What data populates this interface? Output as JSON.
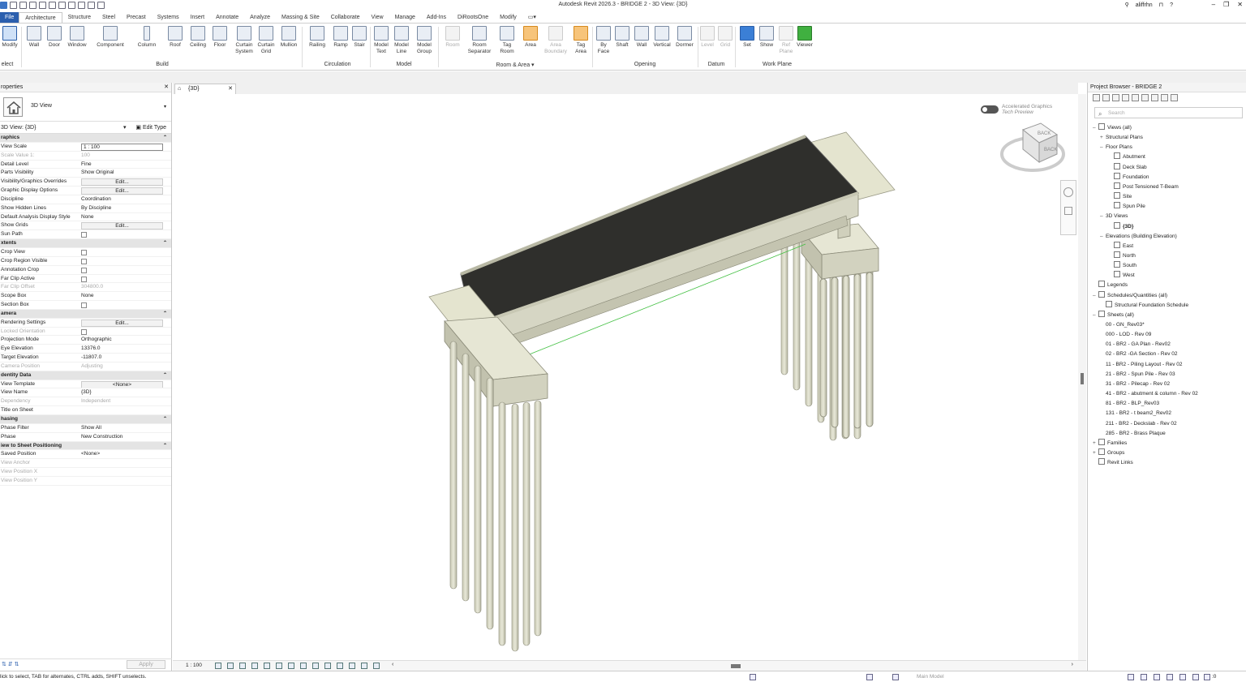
{
  "app": {
    "title": "Autodesk Revit 2026.3 - BRIDGE 2 - 3D View: {3D}",
    "user": "aliffrhn"
  },
  "ribbon": {
    "tabs": [
      "File",
      "Architecture",
      "Structure",
      "Steel",
      "Precast",
      "Systems",
      "Insert",
      "Annotate",
      "Analyze",
      "Massing & Site",
      "Collaborate",
      "View",
      "Manage",
      "Add-Ins",
      "DiRootsOne",
      "Modify"
    ],
    "active_tab": "Architecture",
    "select_label": "elect",
    "tools": {
      "modify": "Modify",
      "wall": "Wall",
      "door": "Door",
      "window": "Window",
      "component": "Component",
      "column": "Column",
      "roof": "Roof",
      "ceiling": "Ceiling",
      "floor": "Floor",
      "curtain_system": "Curtain System",
      "curtain_grid": "Curtain Grid",
      "mullion": "Mullion",
      "railing": "Railing",
      "ramp": "Ramp",
      "stair": "Stair",
      "model_text": "Model Text",
      "model_line": "Model Line",
      "model_group": "Model Group",
      "room": "Room",
      "room_separator": "Room Separator",
      "tag_room": "Tag Room",
      "area": "Area",
      "area_boundary": "Area Boundary",
      "tag_area": "Tag Area",
      "by_face": "By Face",
      "shaft": "Shaft",
      "wall_opening": "Wall",
      "vertical": "Vertical",
      "dormer": "Dormer",
      "level": "Level",
      "grid": "Grid",
      "set": "Set",
      "show": "Show",
      "ref_plane": "Ref Plane",
      "viewer": "Viewer"
    },
    "groups": {
      "build": "Build",
      "circulation": "Circulation",
      "model": "Model",
      "room_area": "Room & Area ▾",
      "opening": "Opening",
      "datum": "Datum",
      "work_plane": "Work Plane"
    }
  },
  "properties": {
    "header": "roperties",
    "type_name": "3D View",
    "selector": "3D View: {3D}",
    "edit_type": "Edit Type",
    "apply": "Apply",
    "help": "Properties help",
    "rows": [
      {
        "kind": "section",
        "k": "raphics"
      },
      {
        "k": "View Scale",
        "v": "1 : 100",
        "ctl": "box"
      },
      {
        "k": "Scale Value    1:",
        "v": "100",
        "dim": true
      },
      {
        "k": "Detail Level",
        "v": "Fine"
      },
      {
        "k": "Parts Visibility",
        "v": "Show Original"
      },
      {
        "k": "Visibility/Graphics Overrides",
        "v": "Edit...",
        "ctl": "btn"
      },
      {
        "k": "Graphic Display Options",
        "v": "Edit...",
        "ctl": "btn"
      },
      {
        "k": "Discipline",
        "v": "Coordination"
      },
      {
        "k": "Show Hidden Lines",
        "v": "By Discipline"
      },
      {
        "k": "Default Analysis Display Style",
        "v": "None"
      },
      {
        "k": "Show Grids",
        "v": "Edit...",
        "ctl": "btn"
      },
      {
        "k": "Sun Path",
        "ctl": "chk"
      },
      {
        "kind": "section",
        "k": "xtents"
      },
      {
        "k": "Crop View",
        "ctl": "chk"
      },
      {
        "k": "Crop Region Visible",
        "ctl": "chk"
      },
      {
        "k": "Annotation Crop",
        "ctl": "chk"
      },
      {
        "k": "Far Clip Active",
        "ctl": "chk"
      },
      {
        "k": "Far Clip Offset",
        "v": "304800.0",
        "dim": true
      },
      {
        "k": "Scope Box",
        "v": "None"
      },
      {
        "k": "Section Box",
        "ctl": "chk"
      },
      {
        "kind": "section",
        "k": "amera"
      },
      {
        "k": "Rendering Settings",
        "v": "Edit...",
        "ctl": "btn"
      },
      {
        "k": "Locked Orientation",
        "ctl": "chk",
        "dim": true
      },
      {
        "k": "Projection Mode",
        "v": "Orthographic"
      },
      {
        "k": "Eye Elevation",
        "v": "13376.0"
      },
      {
        "k": "Target Elevation",
        "v": "-11807.0"
      },
      {
        "k": "Camera Position",
        "v": "Adjusting",
        "dim": true
      },
      {
        "kind": "section",
        "k": "dentity Data"
      },
      {
        "k": "View Template",
        "v": "<None>",
        "ctl": "btn"
      },
      {
        "k": "View Name",
        "v": "{3D}"
      },
      {
        "k": "Dependency",
        "v": "Independent",
        "dim": true
      },
      {
        "k": "Title on Sheet",
        "v": ""
      },
      {
        "kind": "section",
        "k": "hasing"
      },
      {
        "k": "Phase Filter",
        "v": "Show All"
      },
      {
        "k": "Phase",
        "v": "New Construction"
      },
      {
        "kind": "section",
        "k": "iew to Sheet Positioning"
      },
      {
        "k": "Saved Position",
        "v": "<None>"
      },
      {
        "k": "View Anchor",
        "v": "",
        "dim": true
      },
      {
        "k": "View Position X",
        "v": "",
        "dim": true
      },
      {
        "k": "View Position Y",
        "v": "",
        "dim": true
      }
    ]
  },
  "view": {
    "tab_label": "{3D}",
    "scale": "1 : 100",
    "accel_title": "Accelerated Graphics",
    "accel_sub": "Tech Preview",
    "cube_top": "BACK",
    "cube_side": "BACK"
  },
  "browser": {
    "title": "Project Browser - BRIDGE 2",
    "search_placeholder": "Search",
    "tree": [
      {
        "t": "Views (all)",
        "l": 0,
        "tg": "–",
        "ic": true
      },
      {
        "t": "Structural Plans",
        "l": 1,
        "tg": "+"
      },
      {
        "t": "Floor Plans",
        "l": 1,
        "tg": "–"
      },
      {
        "t": "Abutment",
        "l": 2,
        "ic": true
      },
      {
        "t": "Deck Slab",
        "l": 2,
        "ic": true
      },
      {
        "t": "Foundation",
        "l": 2,
        "ic": true
      },
      {
        "t": "Post Tensioned T-Beam",
        "l": 2,
        "ic": true
      },
      {
        "t": "Site",
        "l": 2,
        "ic": true
      },
      {
        "t": "Spun Pile",
        "l": 2,
        "ic": true
      },
      {
        "t": "3D Views",
        "l": 1,
        "tg": "–"
      },
      {
        "t": "{3D}",
        "l": 2,
        "ic": true,
        "bold": true
      },
      {
        "t": "Elevations (Building Elevation)",
        "l": 1,
        "tg": "–"
      },
      {
        "t": "East",
        "l": 2,
        "ic": true
      },
      {
        "t": "North",
        "l": 2,
        "ic": true
      },
      {
        "t": "South",
        "l": 2,
        "ic": true
      },
      {
        "t": "West",
        "l": 2,
        "ic": true
      },
      {
        "t": "Legends",
        "l": 0,
        "ic": true
      },
      {
        "t": "Schedules/Quantities (all)",
        "l": 0,
        "tg": "–",
        "ic": true
      },
      {
        "t": "Structural Foundation Schedule",
        "l": 1,
        "ic": true
      },
      {
        "t": "Sheets (all)",
        "l": 0,
        "tg": "–",
        "ic": true
      },
      {
        "t": "00 - GN_Rev03*",
        "l": 1
      },
      {
        "t": "000 - LOD - Rev 09",
        "l": 1
      },
      {
        "t": "01 - BR2 - GA Plan - Rev02",
        "l": 1
      },
      {
        "t": "02 - BR2 -GA Section - Rev 02",
        "l": 1
      },
      {
        "t": "11 - BR2 - Piling Layout - Rev 02",
        "l": 1
      },
      {
        "t": "21 - BR2 - Spun Pile - Rev 03",
        "l": 1
      },
      {
        "t": "31 - BR2 - Pilecap - Rev 02",
        "l": 1
      },
      {
        "t": "41 - BR2 - abutment & column - Rev 02",
        "l": 1
      },
      {
        "t": "81 - BR2 - BLP_Rev03",
        "l": 1
      },
      {
        "t": "131 - BR2 - t beam2_Rev02",
        "l": 1
      },
      {
        "t": "211 - BR2 - Deckslab - Rev 02",
        "l": 1
      },
      {
        "t": "285 - BR2 - Brass Plaque",
        "l": 1
      },
      {
        "t": "Families",
        "l": 0,
        "tg": "+",
        "ic": true
      },
      {
        "t": "Groups",
        "l": 0,
        "tg": "+",
        "ic": true
      },
      {
        "t": "Revit Links",
        "l": 0,
        "ic": true
      }
    ]
  },
  "status": {
    "text": "lick to select, TAB for alternates, CTRL adds, SHIFT unselects.",
    "workset": "Main Model",
    "coord": ":0"
  }
}
